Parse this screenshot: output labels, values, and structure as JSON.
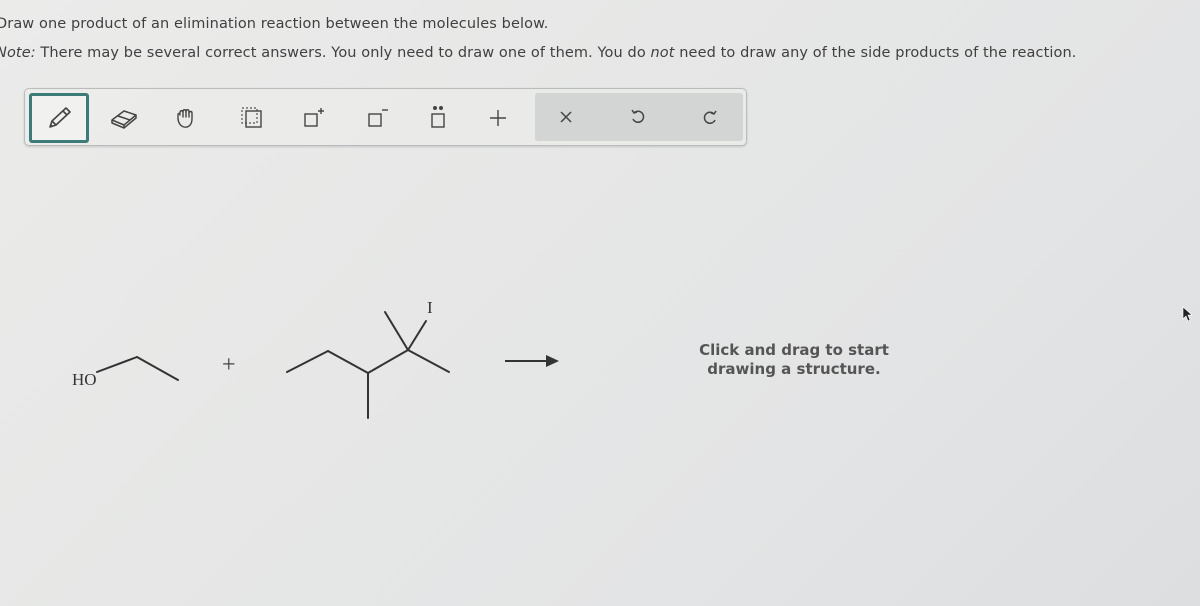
{
  "question": {
    "prompt": "Draw one product of an elimination reaction between the molecules below.",
    "note_label": "Note:",
    "note_part1": " There may be several correct answers. You only need to draw one of them. You do ",
    "note_emphasis": "not",
    "note_part2": " need to draw any of the side products of the reaction."
  },
  "toolbar": {
    "tools": [
      {
        "name": "pencil",
        "icon": "pencil-icon",
        "active": true
      },
      {
        "name": "eraser",
        "icon": "eraser-icon",
        "active": false
      },
      {
        "name": "hand",
        "icon": "hand-icon",
        "active": false
      },
      {
        "name": "select",
        "icon": "lasso-select-icon",
        "active": false
      },
      {
        "name": "add-positive-charge",
        "icon": "positive-charge-icon",
        "active": false
      },
      {
        "name": "add-negative-charge",
        "icon": "negative-charge-icon",
        "active": false
      },
      {
        "name": "add-lone-pair",
        "icon": "lone-pair-icon",
        "active": false
      },
      {
        "name": "add-plus",
        "icon": "plus-icon",
        "active": false
      }
    ],
    "actions": [
      {
        "name": "clear",
        "icon": "close-icon"
      },
      {
        "name": "undo",
        "icon": "undo-icon"
      },
      {
        "name": "redo",
        "icon": "redo-icon"
      }
    ],
    "charge_plus": "+",
    "charge_minus": "−"
  },
  "reaction": {
    "reactant1": {
      "name": "ethanol",
      "label": "HO"
    },
    "plus": "+",
    "reactant2": {
      "name": "3-iodo-2,3-dimethylpentane-like alkyl iodide",
      "label": "I"
    },
    "arrow": "reaction-arrow"
  },
  "canvas": {
    "hint": "Click and drag to start drawing a structure."
  },
  "colors": {
    "active_tool_border": "#3d7b79",
    "action_panel_bg": "#d2d5d4",
    "text": "#404040"
  }
}
